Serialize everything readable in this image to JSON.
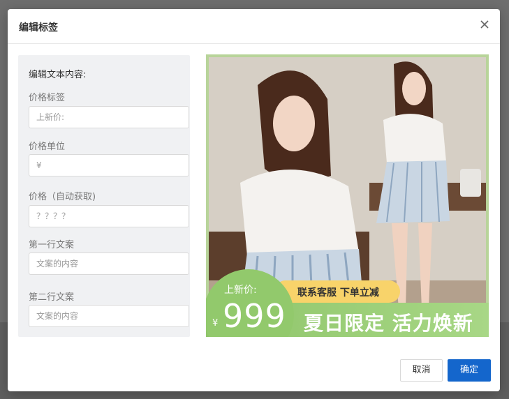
{
  "dialog": {
    "title": "编辑标签",
    "close_icon": "close-icon"
  },
  "form": {
    "heading": "编辑文本内容:",
    "fields": [
      {
        "label": "价格标签",
        "placeholder": "上新价:"
      },
      {
        "label": "价格单位",
        "placeholder": "¥"
      },
      {
        "label": "价格（自动获取)",
        "placeholder": "？？？？"
      },
      {
        "label": "第一行文案",
        "placeholder": "文案的内容"
      },
      {
        "label": "第二行文案",
        "placeholder": "文案的内容"
      }
    ]
  },
  "preview": {
    "price_label": "上新价:",
    "currency": "¥",
    "price": "999",
    "pill_text": "联系客服  下单立减",
    "promo_text": "夏日限定 活力焕新",
    "colors": {
      "banner": "#9dd07a",
      "pill": "#f8d36a",
      "frame": "#b8d49a"
    }
  },
  "footer": {
    "cancel_label": "取消",
    "ok_label": "确定",
    "ok_color": "#1466cc"
  }
}
